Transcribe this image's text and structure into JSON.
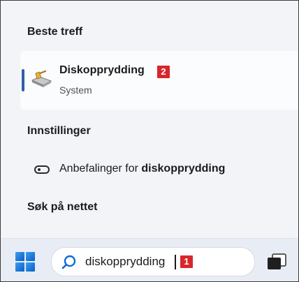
{
  "sections": {
    "best_match": "Beste treff",
    "settings": "Innstillinger",
    "web_search": "Søk på nettet"
  },
  "best_match_item": {
    "name": "Diskopprydding",
    "subtitle": "System",
    "badge": "2",
    "icon": "disk-cleanup-icon"
  },
  "settings_items": [
    {
      "prefix": "Anbefalinger for ",
      "highlight": "diskopprydding",
      "icon": "toggle-settings-icon"
    }
  ],
  "taskbar": {
    "start_icon": "windows-logo-icon",
    "search_value": "diskopprydding",
    "search_badge": "1",
    "task_view_icon": "task-view-icon"
  },
  "colors": {
    "accent": "#2f5fa8",
    "badge_red": "#d9262d",
    "windows_blue": "#0a6cd6"
  }
}
